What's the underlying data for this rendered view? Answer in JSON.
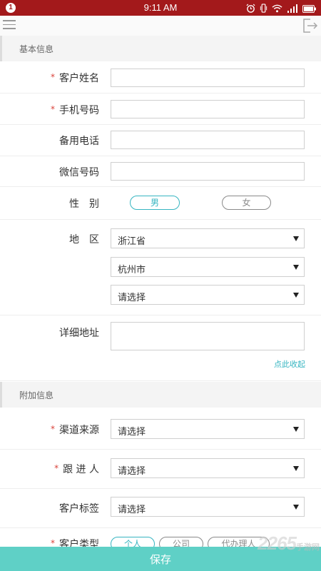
{
  "status_bar": {
    "notification_count": "1",
    "time": "9:11 AM"
  },
  "sections": {
    "basic": "基本信息",
    "extra": "附加信息"
  },
  "fields": {
    "name": {
      "label": "客户姓名",
      "required": "*",
      "value": ""
    },
    "phone": {
      "label": "手机号码",
      "required": "*",
      "value": ""
    },
    "backup_phone": {
      "label": "备用电话",
      "value": ""
    },
    "wechat": {
      "label": "微信号码",
      "value": ""
    },
    "gender": {
      "label": "性　别",
      "options": [
        "男",
        "女"
      ],
      "selected": "男"
    },
    "region": {
      "label": "地　区",
      "province": "浙江省",
      "city": "杭州市",
      "district": "请选择"
    },
    "address": {
      "label": "详细地址",
      "value": "",
      "collapse_link": "点此收起"
    },
    "channel": {
      "label": "渠道来源",
      "required": "*",
      "value": "请选择"
    },
    "follower": {
      "label": "跟 进 人",
      "required": "*",
      "value": "请选择"
    },
    "tags": {
      "label": "客户标签",
      "value": "请选择"
    },
    "customer_type": {
      "label": "客户类型",
      "required": "*",
      "options": [
        "个人",
        "公司",
        "代办理人"
      ],
      "selected": "个人"
    }
  },
  "save_button": "保存",
  "watermark": {
    "main": "2265",
    "sub": "手游网"
  },
  "colors": {
    "status_bar": "#a3191b",
    "accent": "#36b5c1",
    "save_bar": "#5fd0c6",
    "required": "#d9423a"
  }
}
